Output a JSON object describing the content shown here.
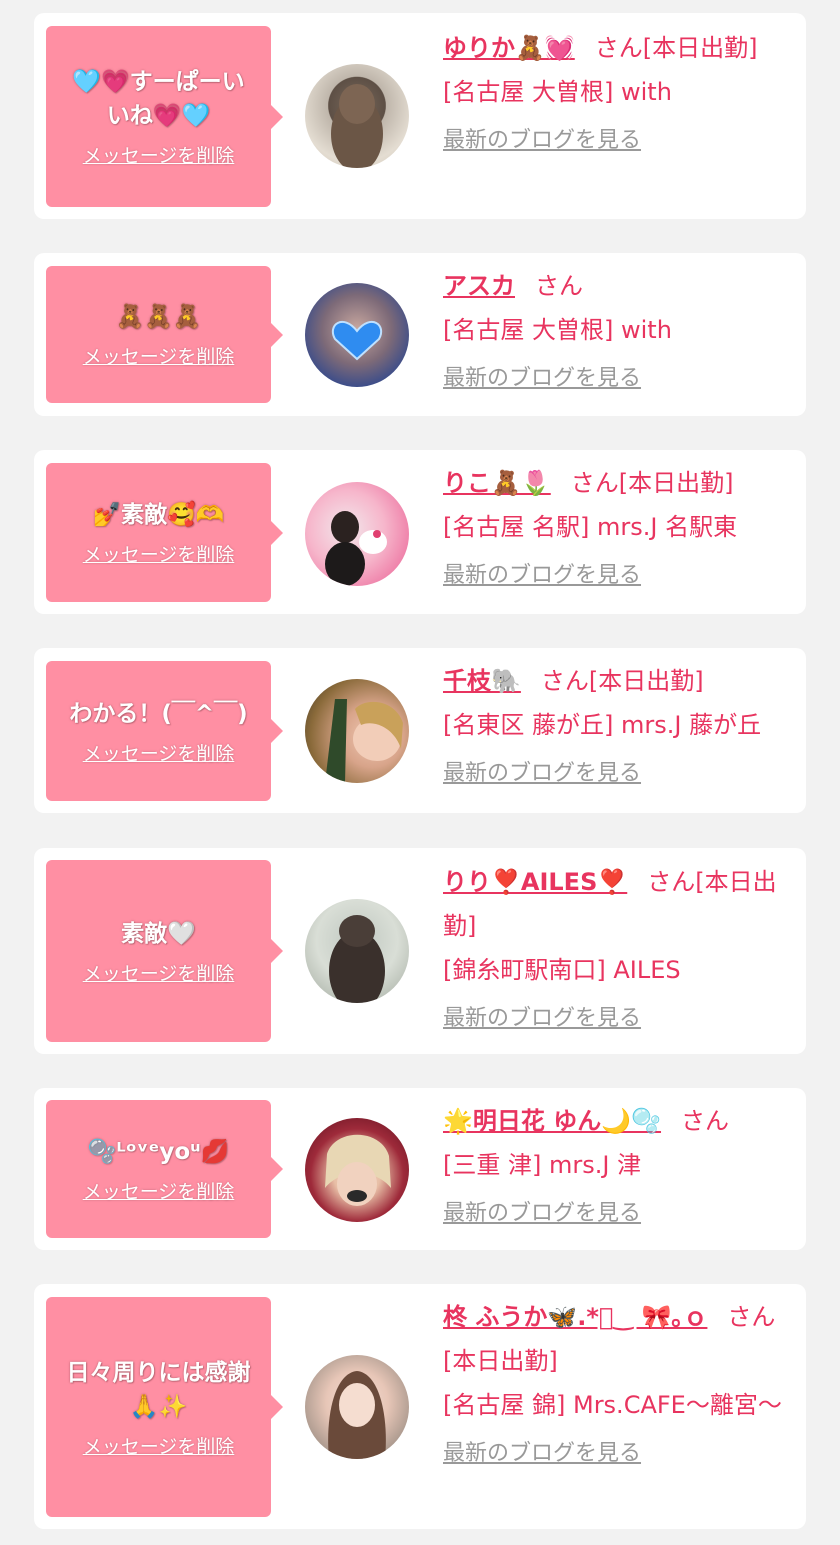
{
  "delete_label": "メッセージを削除",
  "blog_label": "最新のブログを見る",
  "san_label": "さん",
  "colors": {
    "background": "#f2f2f2",
    "card": "#ffffff",
    "bubble": "#ff8fa3",
    "accent": "#e8345f",
    "link_gray": "#999999"
  },
  "cards": [
    {
      "message": "🩵💗すーぱーいいね💗🩵",
      "name": "ゆりか🧸💓",
      "status": "[本日出勤]",
      "shop": "[名古屋 大曽根] with",
      "avatar_icon": "woman-photo-icon"
    },
    {
      "message": "🧸🧸🧸",
      "name": "アスカ",
      "status": "",
      "shop": "[名古屋 大曽根] with",
      "avatar_icon": "woman-photo-icon"
    },
    {
      "message": "💅素敵🥰🫶",
      "name": "りこ🧸🌷",
      "status": "[本日出勤]",
      "shop": "[名古屋 名駅] mrs.J 名駅東",
      "avatar_icon": "woman-photo-icon"
    },
    {
      "message": "わかる！(￣^￣)",
      "name": "千枝🐘",
      "status": "[本日出勤]",
      "shop": "[名東区 藤が丘] mrs.J 藤が丘",
      "avatar_icon": "woman-photo-icon"
    },
    {
      "message": "素敵🤍",
      "name": "りり❣️AILES❣️",
      "status": "[本日出勤]",
      "shop": "[錦糸町駅南口] AILES",
      "avatar_icon": "woman-photo-icon"
    },
    {
      "message": "🫧ᴸᵒᵛᵉyoᵘ💋",
      "name": "🌟明日花 ゆん🌙🫧",
      "status": "",
      "shop": "[三重 津] mrs.J 津",
      "avatar_icon": "woman-photo-icon"
    },
    {
      "message": "日々周りには感謝🙏✨",
      "name": "柊 ふうか🦋.*ﾟ‿ 🎀｡ｏ",
      "status": "[本日出勤]",
      "shop": "[名古屋 錦] Mrs.CAFE～離宮～",
      "avatar_icon": "woman-photo-icon"
    }
  ]
}
